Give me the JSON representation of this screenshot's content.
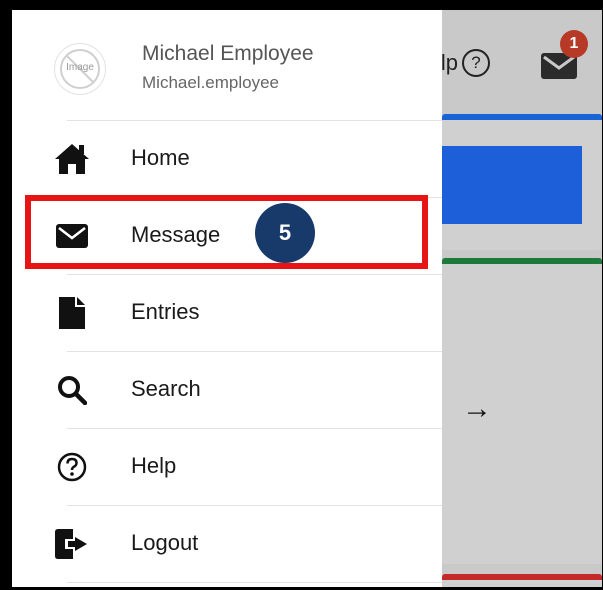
{
  "header": {
    "help_label": "Help",
    "help_icon": "?",
    "mail_badge_count": "1"
  },
  "background": {
    "arrow": "→"
  },
  "profile": {
    "avatar_text": "Image",
    "name": "Michael Employee",
    "username": "Michael.employee"
  },
  "menu": {
    "items": [
      {
        "label": "Home",
        "icon": "home-icon"
      },
      {
        "label": "Message",
        "icon": "envelope-icon"
      },
      {
        "label": "Entries",
        "icon": "file-icon"
      },
      {
        "label": "Search",
        "icon": "search-icon"
      },
      {
        "label": "Help",
        "icon": "help-icon"
      },
      {
        "label": "Logout",
        "icon": "logout-icon"
      }
    ]
  },
  "annotation": {
    "step_number": "5",
    "highlight_color": "#e61414",
    "badge_color": "#173a6b"
  }
}
